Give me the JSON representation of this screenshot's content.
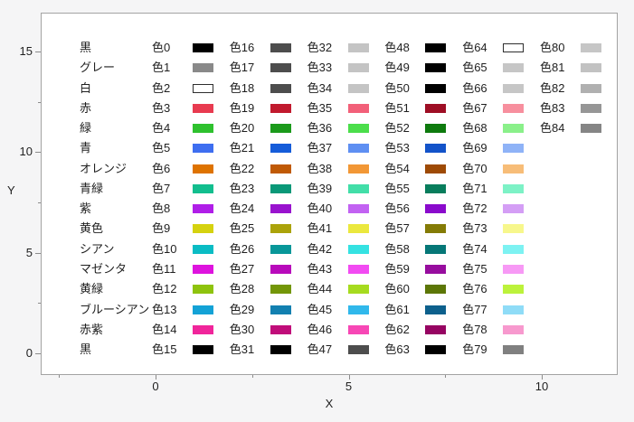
{
  "figure": {
    "canvas_bg": "#f5f5f6",
    "plot_bg": "#ffffff",
    "frame_color": "#a3a3a3",
    "tick_color": "#8c8c8c",
    "text_color": "#1f1f1f",
    "white_swatch_border": "#2e2e2e"
  },
  "chart_data": {
    "type": "scatter",
    "title": "",
    "xlabel": "X",
    "ylabel": "Y",
    "xlim": [
      -3,
      12
    ],
    "ylim": [
      -1.1,
      16.9
    ],
    "grid": false,
    "legend_position": "none",
    "x_major_ticks": [
      0,
      5,
      10
    ],
    "x_minor_ticks": [
      -2.5,
      2.5,
      7.5
    ],
    "y_major_ticks": [
      0,
      5,
      10,
      15
    ],
    "y_minor_ticks": [
      2.5,
      7.5,
      12.5
    ],
    "row_names": [
      "黒",
      "グレー",
      "白",
      "赤",
      "緑",
      "青",
      "オレンジ",
      "青緑",
      "紫",
      "黄色",
      "シアン",
      "マゼンタ",
      "黄緑",
      "ブルーシアン",
      "赤紫",
      "黒"
    ],
    "row_y_values": [
      15,
      14,
      13,
      12,
      11,
      10,
      9,
      8,
      7,
      6,
      5,
      4,
      3,
      2,
      1,
      0
    ],
    "name_column_x": -2,
    "columns": [
      {
        "x": 0,
        "labels": [
          "色0",
          "色1",
          "色2",
          "色3",
          "色4",
          "色5",
          "色6",
          "色7",
          "色8",
          "色9",
          "色10",
          "色11",
          "色12",
          "色13",
          "色14",
          "色15"
        ],
        "colors": [
          "#000000",
          "#898989",
          "#ffffff",
          "#e83b50",
          "#2ec12e",
          "#3e6ef0",
          "#de7300",
          "#12be8e",
          "#b01ee8",
          "#d5d20f",
          "#0abcc4",
          "#de13de",
          "#8ec30d",
          "#13a2d6",
          "#f0259b",
          "#000000"
        ]
      },
      {
        "x": 2,
        "labels": [
          "色16",
          "色17",
          "色18",
          "色19",
          "色20",
          "色21",
          "色22",
          "色23",
          "色24",
          "色25",
          "色26",
          "色27",
          "色28",
          "色29",
          "色30",
          "色31"
        ],
        "colors": [
          "#4d4d4d",
          "#4d4d4d",
          "#4d4d4d",
          "#c11a2e",
          "#1b9a1b",
          "#155cd9",
          "#c05a05",
          "#0a9878",
          "#9913ce",
          "#aba30a",
          "#089799",
          "#b80abb",
          "#739608",
          "#1280b0",
          "#c00d7a",
          "#000000"
        ]
      },
      {
        "x": 4,
        "labels": [
          "色32",
          "色33",
          "色34",
          "色35",
          "色36",
          "色37",
          "色38",
          "色39",
          "色40",
          "色41",
          "色42",
          "色43",
          "色44",
          "色45",
          "色46",
          "色47"
        ],
        "colors": [
          "#c4c4c4",
          "#c4c4c4",
          "#c4c4c4",
          "#f26079",
          "#4bde4b",
          "#5e8ff2",
          "#f29735",
          "#42dea8",
          "#c262f2",
          "#ebe83e",
          "#35e2e2",
          "#f24bf2",
          "#a6db1f",
          "#30b8eb",
          "#f747b5",
          "#4d4d4d"
        ]
      },
      {
        "x": 6,
        "labels": [
          "色48",
          "色49",
          "色50",
          "色51",
          "色52",
          "色53",
          "色54",
          "色55",
          "色56",
          "色57",
          "色58",
          "色59",
          "色60",
          "色61",
          "色62",
          "色63"
        ],
        "colors": [
          "#000000",
          "#000000",
          "#000000",
          "#9e0e24",
          "#0e7a0e",
          "#1353c9",
          "#9e4a05",
          "#087d5c",
          "#8a0acc",
          "#847b06",
          "#067777",
          "#970d9e",
          "#5c7606",
          "#0d608c",
          "#960462",
          "#000000"
        ]
      },
      {
        "x": 8,
        "labels": [
          "色64",
          "色65",
          "色66",
          "色67",
          "色68",
          "色69",
          "色70",
          "色71",
          "色72",
          "色73",
          "色74",
          "色75",
          "色76",
          "色77",
          "色78",
          "色79"
        ],
        "colors": [
          "#ffffff",
          "#c6c6c6",
          "#c6c6c6",
          "#f78f9e",
          "#8af08a",
          "#8fb3f7",
          "#f7bd78",
          "#7df2c6",
          "#d49ef5",
          "#f7f78c",
          "#7df2f2",
          "#f799f5",
          "#bcf23b",
          "#8fdcf7",
          "#f799ce",
          "#808080"
        ]
      },
      {
        "x": 10,
        "labels": [
          "色80",
          "色81",
          "色82",
          "色83",
          "色84"
        ],
        "colors": [
          "#c6c6c6",
          "#c2c2c2",
          "#b0b0b0",
          "#969696",
          "#858585"
        ]
      }
    ]
  }
}
